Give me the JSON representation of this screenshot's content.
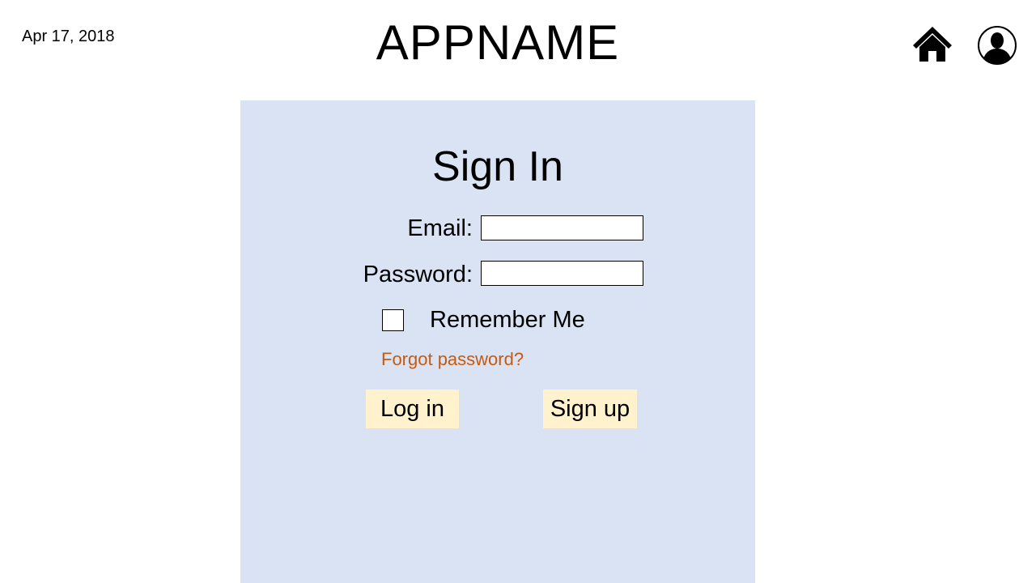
{
  "header": {
    "date": "Apr 17, 2018",
    "app_name": "APPNAME",
    "home_icon": "home-icon",
    "profile_icon": "user-profile-icon"
  },
  "signin": {
    "title": "Sign In",
    "email_label": "Email:",
    "email_value": "",
    "password_label": "Password:",
    "password_value": "",
    "remember_label": "Remember Me",
    "remember_checked": false,
    "forgot_link": "Forgot password?",
    "login_button": "Log in",
    "signup_button": "Sign up"
  },
  "colors": {
    "panel_bg": "#dae3f3",
    "button_bg": "#fff2cc",
    "link": "#c55a11"
  }
}
